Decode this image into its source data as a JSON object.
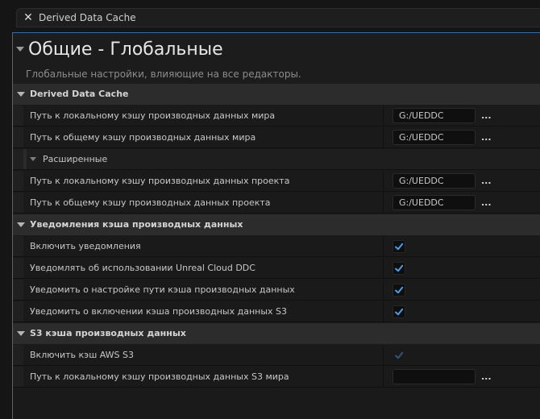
{
  "tab": {
    "title": "Derived Data Cache",
    "close_icon": "close-icon"
  },
  "header": {
    "title": "Общие - Глобальные",
    "description": "Глобальные настройки, влияющие на все редакторы."
  },
  "sections": {
    "ddc": {
      "label": "Derived Data Cache",
      "local_world_label": "Путь к локальному кэшу производных данных мира",
      "local_world_value": "G:/UEDDC",
      "shared_world_label": "Путь к общему кэшу производных данных мира",
      "shared_world_value": "G:/UEDDC",
      "advanced_label": "Расширенные",
      "local_project_label": "Путь к локальному кэшу производных данных проекта",
      "local_project_value": "G:/UEDDC",
      "shared_project_label": "Путь к общему кэшу производных данных проекта",
      "shared_project_value": "G:/UEDDC",
      "browse": "..."
    },
    "notifications": {
      "label": "Уведомления кэша производных данных",
      "enable_label": "Включить уведомления",
      "unreal_cloud_label": "Уведомлять об использовании Unreal Cloud DDC",
      "path_setup_label": "Уведомить о настройке пути кэша производных данных",
      "s3_enable_label": "Уведомить о включении кэша производных данных S3"
    },
    "s3": {
      "label": "S3 кэша производных данных",
      "aws_label": "Включить кэш AWS S3",
      "local_path_label": "Путь к локальному кэшу производных данных S3 мира",
      "local_path_value": "",
      "browse": "..."
    }
  },
  "colors": {
    "accent": "#2b6ea8",
    "check_enabled": "#4a9eea",
    "check_disabled": "#2f5778"
  }
}
